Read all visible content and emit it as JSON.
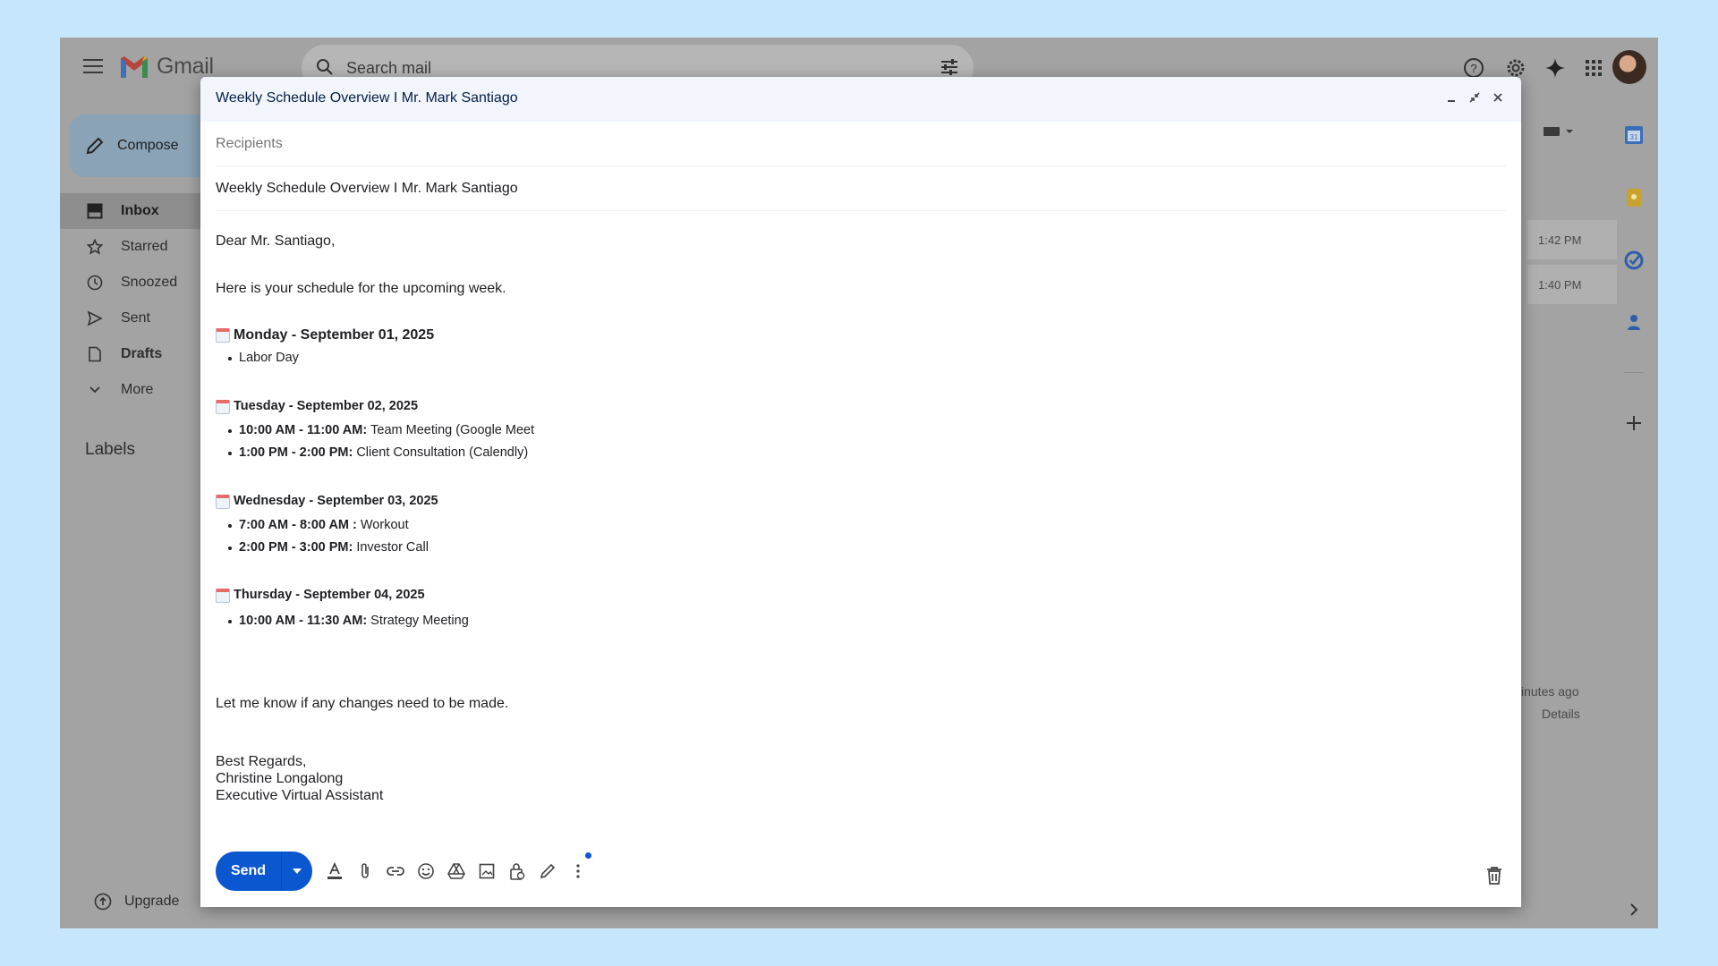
{
  "header": {
    "app_name": "Gmail",
    "search_placeholder": "Search mail"
  },
  "sidebar": {
    "compose_label": "Compose",
    "items": [
      {
        "label": "Inbox",
        "icon": "inbox-icon",
        "active": true
      },
      {
        "label": "Starred",
        "icon": "star-icon"
      },
      {
        "label": "Snoozed",
        "icon": "clock-icon"
      },
      {
        "label": "Sent",
        "icon": "send-icon"
      },
      {
        "label": "Drafts",
        "icon": "draft-icon"
      },
      {
        "label": "More",
        "icon": "chevron-down-icon"
      }
    ],
    "labels_heading": "Labels",
    "upgrade_label": "Upgrade"
  },
  "background_list": {
    "times": [
      "1:42 PM",
      "1:40 PM"
    ],
    "activity": "inutes ago",
    "details": "Details"
  },
  "compose": {
    "window_title": "Weekly Schedule Overview I Mr. Mark Santiago",
    "recipients_placeholder": "Recipients",
    "subject": "Weekly Schedule Overview I Mr. Mark Santiago",
    "greeting": "Dear Mr. Santiago,",
    "intro": "Here is your schedule for the upcoming week.",
    "days": [
      {
        "title": "Monday - September 01, 2025",
        "events": [
          {
            "time": "",
            "desc": "Labor Day"
          }
        ]
      },
      {
        "title": "Tuesday - September 02, 2025",
        "events": [
          {
            "time": "10:00 AM - 11:00 AM:",
            "desc": "Team Meeting (Google Meet"
          },
          {
            "time": "1:00 PM - 2:00 PM:",
            "desc": "Client Consultation (Calendly)"
          }
        ]
      },
      {
        "title": "Wednesday - September 03, 2025",
        "events": [
          {
            "time": "7:00 AM - 8:00 AM :",
            "desc": "Workout"
          },
          {
            "time": "2:00 PM - 3:00 PM:",
            "desc": "Investor Call"
          }
        ]
      },
      {
        "title": "Thursday - September 04, 2025",
        "events": [
          {
            "time": "10:00 AM - 11:30 AM:",
            "desc": "Strategy Meeting"
          }
        ]
      }
    ],
    "closing_line": "Let me know if any changes need to be made.",
    "signature": [
      "Best Regards,",
      "Christine Longalong",
      "Executive Virtual Assistant"
    ],
    "send_label": "Send"
  },
  "colors": {
    "send_button": "#0b57d0",
    "dialog_header": "#f2f6fc",
    "page_background": "#c6e7fb"
  }
}
